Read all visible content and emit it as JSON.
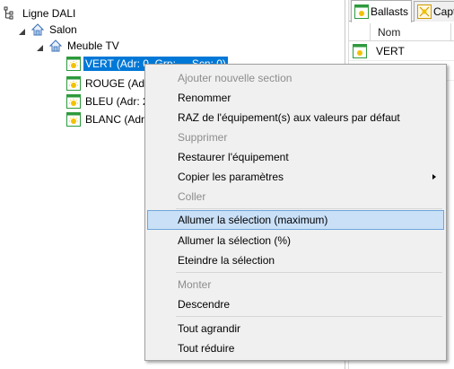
{
  "tree": {
    "nodes": [
      {
        "label": "Ligne DALI"
      },
      {
        "label": "Salon"
      },
      {
        "label": "Meuble TV"
      },
      {
        "label": "VERT (Adr: 0, Grp: --, Scn: 0)"
      },
      {
        "label": "ROUGE (Adr"
      },
      {
        "label": "BLEU (Adr: 2"
      },
      {
        "label": "BLANC (Adr"
      }
    ]
  },
  "right_panel": {
    "tabs": [
      {
        "label": "Ballasts"
      },
      {
        "label": "Capt"
      }
    ],
    "grid": {
      "column_name": "Nom",
      "rows": [
        {
          "name": "VERT"
        }
      ]
    }
  },
  "context_menu": {
    "items": [
      {
        "label": "Ajouter nouvelle section",
        "disabled": true
      },
      {
        "label": "Renommer",
        "disabled": false
      },
      {
        "label": "RAZ de l'équipement(s) aux valeurs par défaut",
        "disabled": false
      },
      {
        "label": "Supprimer",
        "disabled": true
      },
      {
        "label": "Restaurer l'équipement",
        "disabled": false
      },
      {
        "label": "Copier les paramètres",
        "disabled": false,
        "submenu": true
      },
      {
        "label": "Coller",
        "disabled": true
      },
      {
        "label": "Allumer la sélection (maximum)",
        "disabled": false,
        "highlighted": true
      },
      {
        "label": "Allumer la sélection (%)",
        "disabled": false
      },
      {
        "label": "Eteindre la sélection",
        "disabled": false
      },
      {
        "label": "Monter",
        "disabled": true
      },
      {
        "label": "Descendre",
        "disabled": false
      },
      {
        "label": "Tout agrandir",
        "disabled": false
      },
      {
        "label": "Tout réduire",
        "disabled": false
      }
    ]
  },
  "colors": {
    "selection": "#0078d7",
    "menu_background": "#f0f0f0",
    "menu_highlight": "#c9e0f7",
    "disabled_text": "#8d8d8d",
    "ballast_icon_green": "#2e9a3c",
    "ballast_icon_yellow": "#f2c200"
  }
}
